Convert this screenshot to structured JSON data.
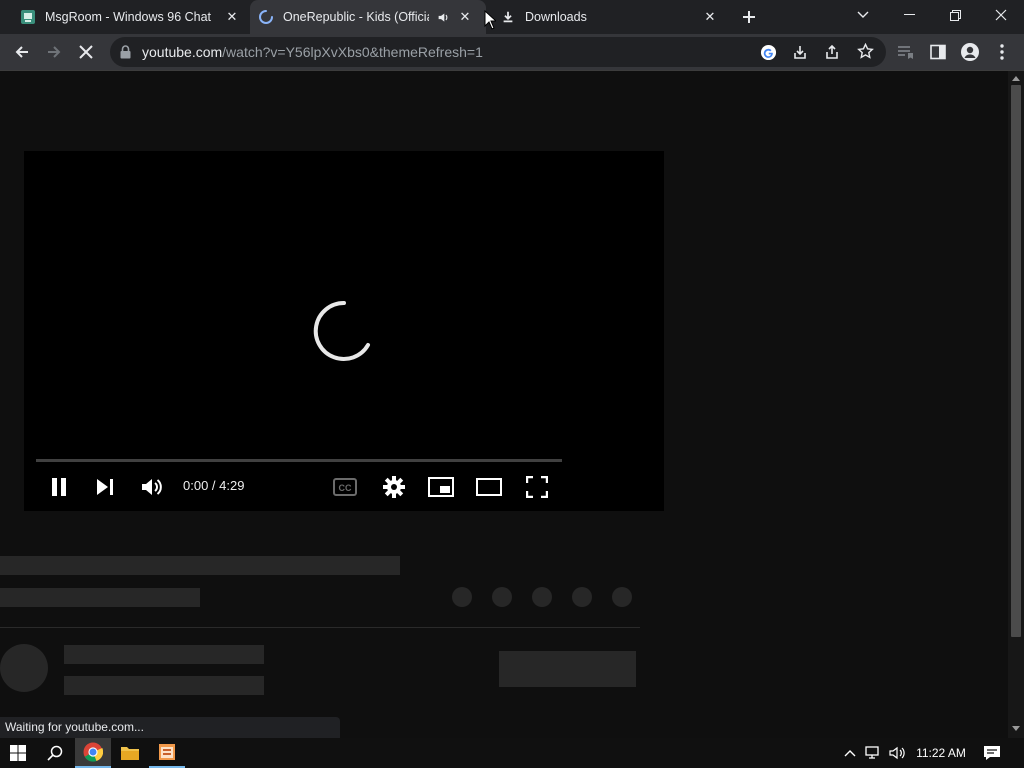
{
  "browser": {
    "tabs": [
      {
        "title": "MsgRoom - Windows 96 Chat",
        "icon": "msgroom-favicon-icon",
        "active": false
      },
      {
        "title": "OneRepublic - Kids (Official Music Video)",
        "icon": "loading-spinner-icon",
        "active": true,
        "audio": "speaker-icon"
      },
      {
        "title": "Downloads",
        "icon": "download-icon",
        "active": false
      }
    ],
    "new_tab_icon": "plus-icon",
    "url_host": "youtube.com",
    "url_path": "/watch?v=Y56lpXvXbs0&themeRefresh=1",
    "status_text": "Waiting for youtube.com..."
  },
  "player": {
    "time": "0:00 / 4:29",
    "progress": 0,
    "state": "loading"
  },
  "taskbar": {
    "clock": "11:22 AM"
  },
  "colors": {
    "tabstrip": "#202124",
    "toolbar": "#35363a",
    "page_bg": "#0f0f0f",
    "player_bg": "#000000",
    "skeleton": "#272727"
  }
}
